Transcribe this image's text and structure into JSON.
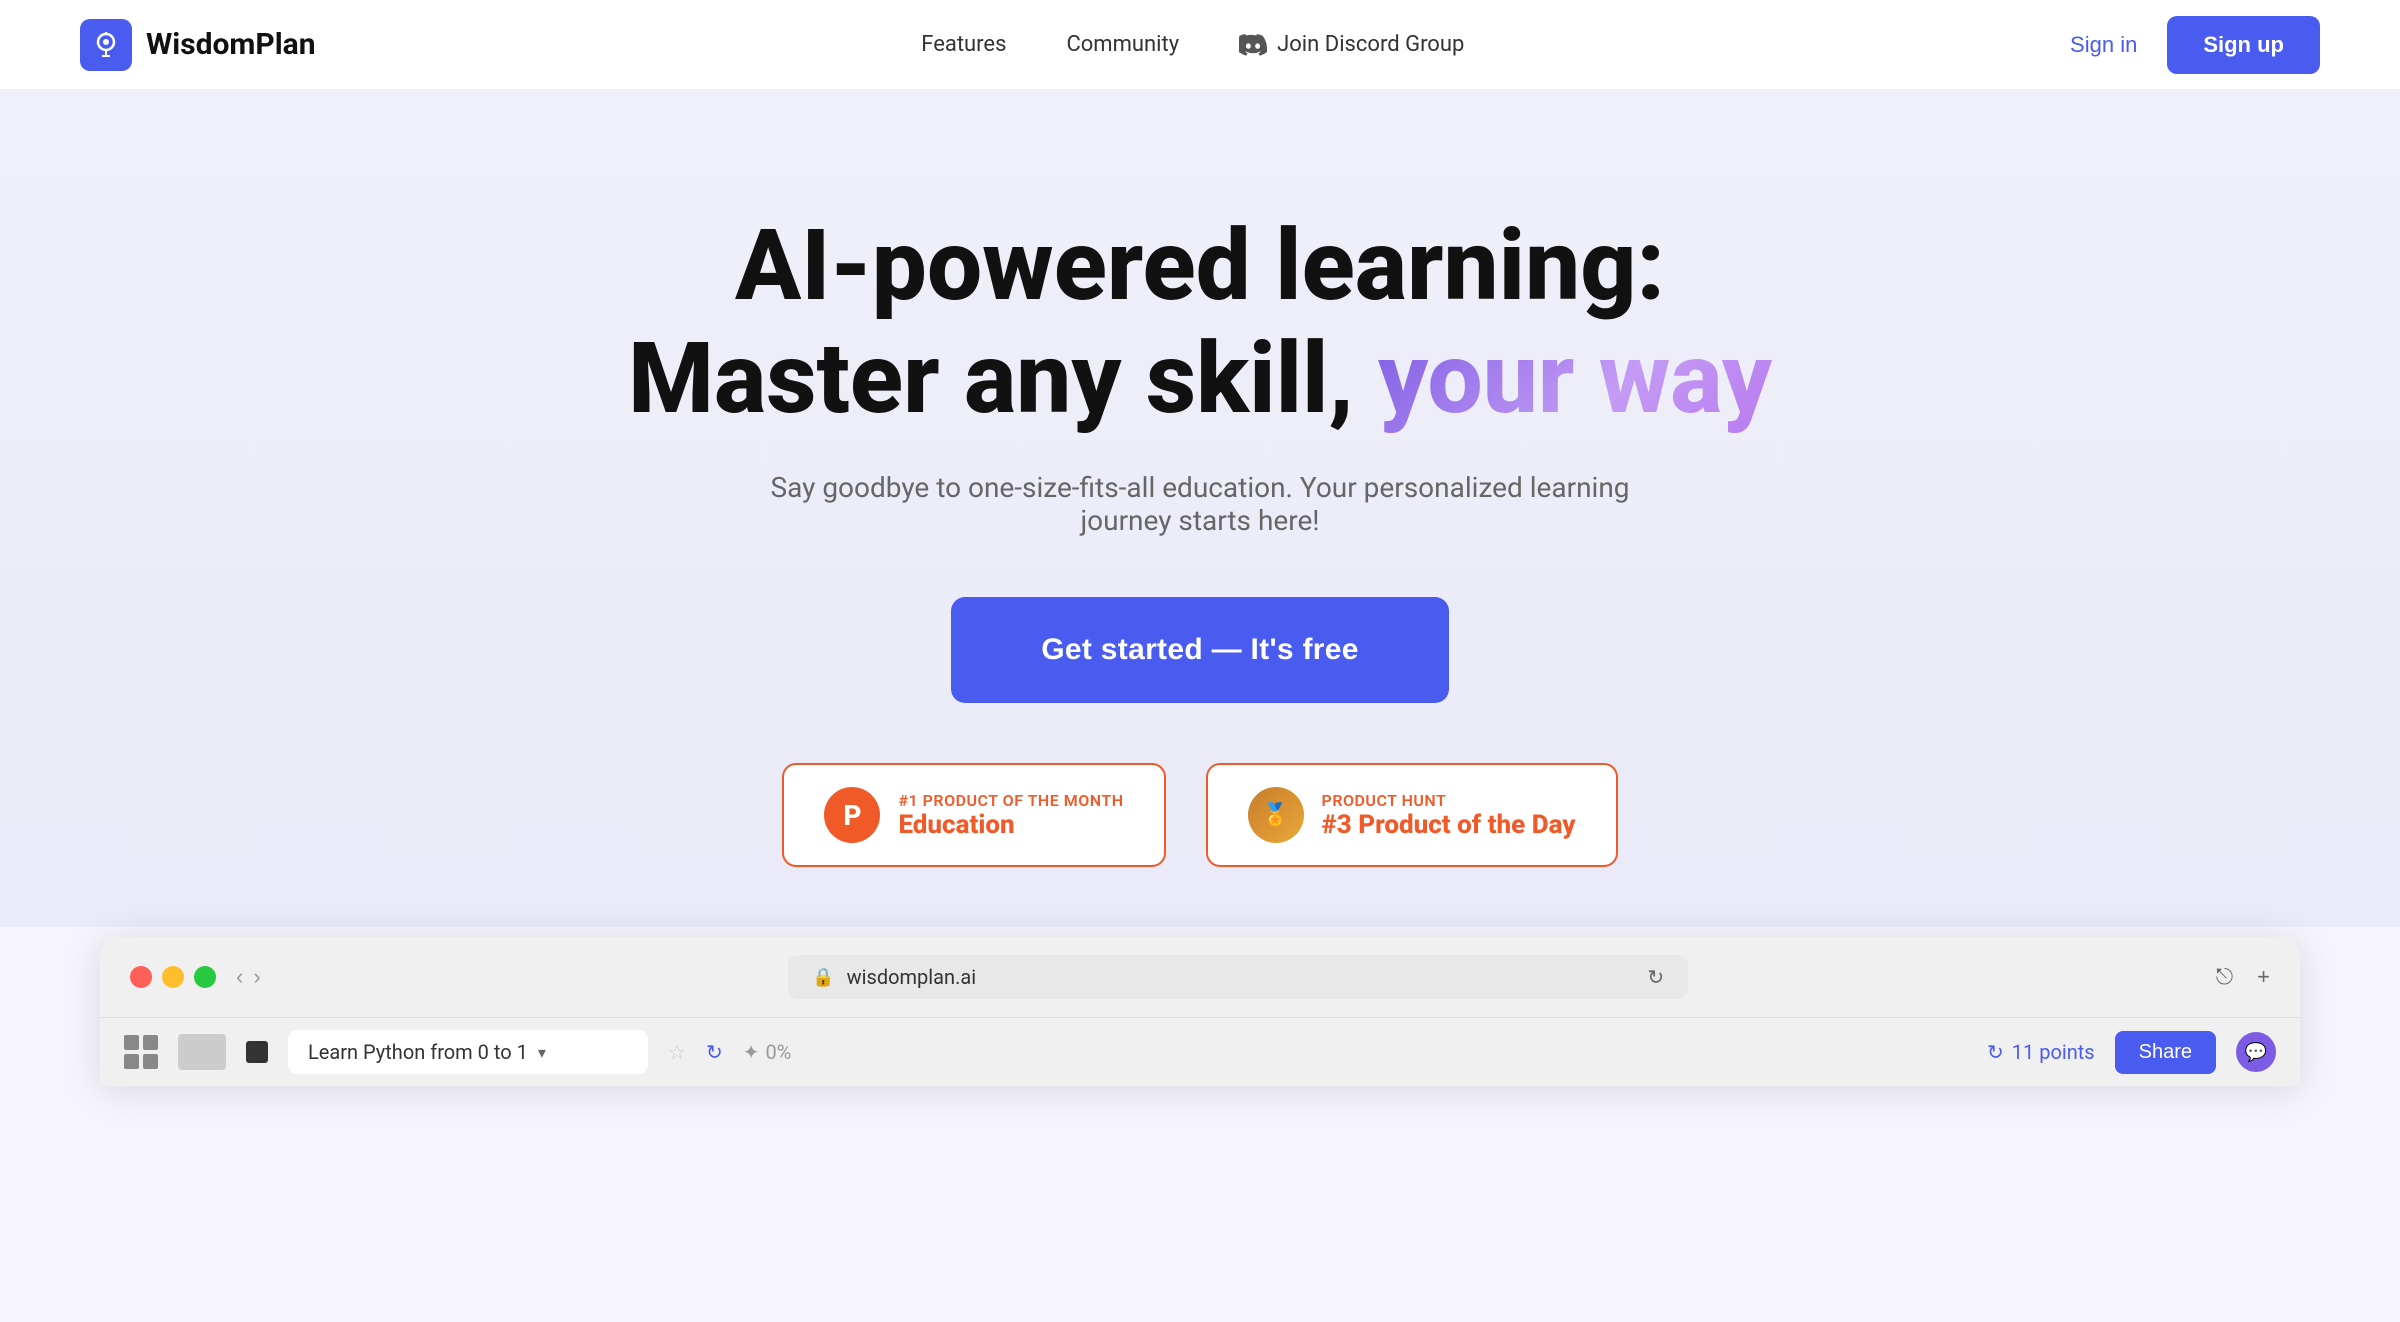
{
  "nav": {
    "logo_text": "WisdomPlan",
    "links": [
      {
        "label": "Features",
        "id": "features"
      },
      {
        "label": "Community",
        "id": "community"
      },
      {
        "label": "Join Discord Group",
        "id": "discord"
      }
    ],
    "signin_label": "Sign in",
    "signup_label": "Sign up"
  },
  "hero": {
    "title_line1": "AI-powered learning:",
    "title_line2": "Master any skill,",
    "title_gradient": "your way",
    "subtitle": "Say goodbye to one-size-fits-all education. Your personalized learning journey starts here!",
    "cta_label": "Get started — It's free"
  },
  "badges": [
    {
      "id": "ph-education",
      "icon_label": "P",
      "label": "#1 PRODUCT OF THE MONTH",
      "value": "Education"
    },
    {
      "id": "ph-day",
      "icon_label": "🏅",
      "label": "PRODUCT HUNT",
      "value": "#3 Product of the Day"
    }
  ],
  "browser": {
    "url": "wisdomplan.ai",
    "tab_title": "Learn Python from 0 to 1",
    "points_label": "11 points",
    "share_label": "Share",
    "progress_label": "0%",
    "back_label": "‹",
    "forward_label": "›",
    "reload_label": "↻",
    "add_tab_label": "+"
  },
  "colors": {
    "primary": "#4A5CF0",
    "accent_orange": "#f05a28",
    "gradient_purple_start": "#7c5ce4",
    "gradient_purple_end": "#c49bf5"
  }
}
